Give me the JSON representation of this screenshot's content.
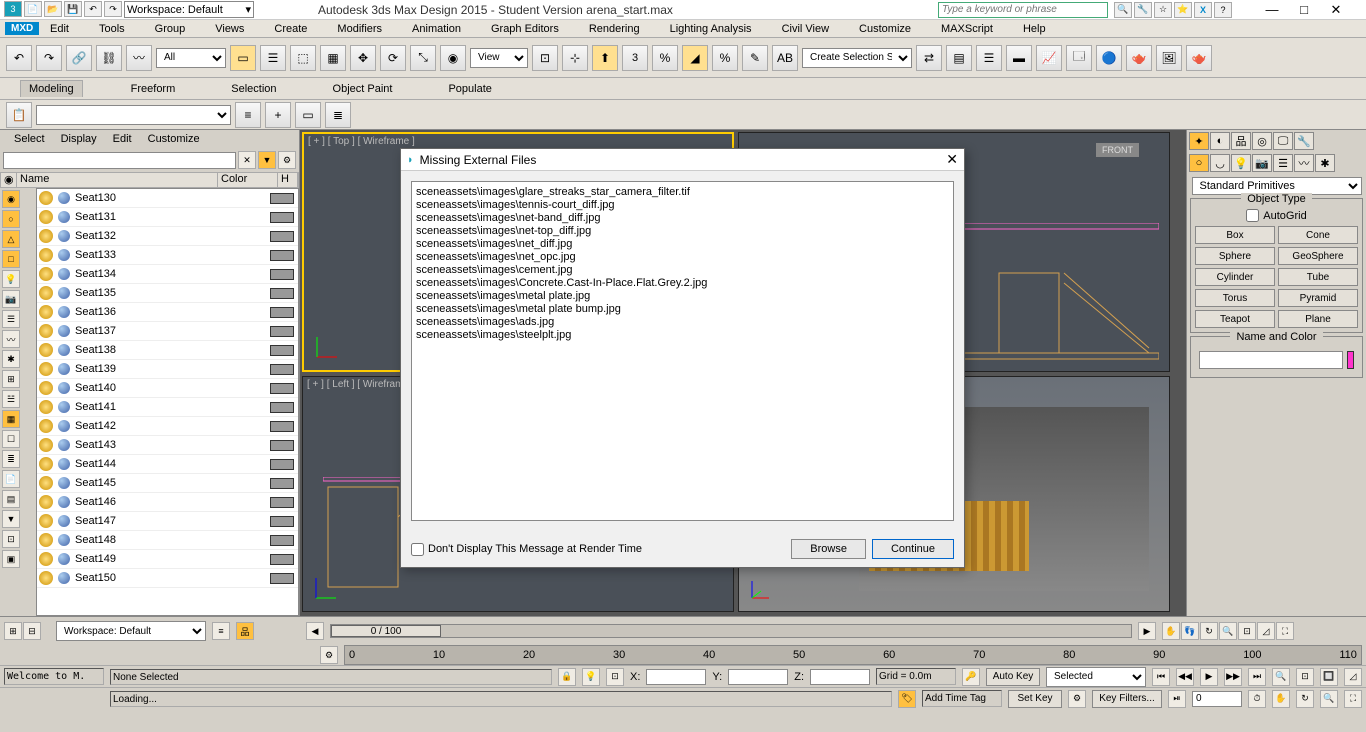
{
  "titlebar": {
    "workspace_label": "Workspace: Default",
    "app_title": "Autodesk 3ds Max Design 2015  - Student Version    arena_start.max",
    "search_placeholder": "Type a keyword or phrase"
  },
  "menubar": [
    "Edit",
    "Tools",
    "Group",
    "Views",
    "Create",
    "Modifiers",
    "Animation",
    "Graph Editors",
    "Rendering",
    "Lighting Analysis",
    "Civil View",
    "Customize",
    "MAXScript",
    "Help"
  ],
  "toolbar": {
    "filter_all": "All",
    "view": "View",
    "angle": "3",
    "selection_set": "Create Selection Se"
  },
  "ribbon_tabs": [
    "Modeling",
    "Freeform",
    "Selection",
    "Object Paint",
    "Populate"
  ],
  "scene_panel": {
    "menus": [
      "Select",
      "Display",
      "Edit",
      "Customize"
    ],
    "columns": {
      "name": "Name",
      "color": "Color",
      "h": "H"
    },
    "items": [
      {
        "name": "Seat130"
      },
      {
        "name": "Seat131"
      },
      {
        "name": "Seat132"
      },
      {
        "name": "Seat133"
      },
      {
        "name": "Seat134"
      },
      {
        "name": "Seat135"
      },
      {
        "name": "Seat136"
      },
      {
        "name": "Seat137"
      },
      {
        "name": "Seat138"
      },
      {
        "name": "Seat139"
      },
      {
        "name": "Seat140"
      },
      {
        "name": "Seat141"
      },
      {
        "name": "Seat142"
      },
      {
        "name": "Seat143"
      },
      {
        "name": "Seat144"
      },
      {
        "name": "Seat145"
      },
      {
        "name": "Seat146"
      },
      {
        "name": "Seat147"
      },
      {
        "name": "Seat148"
      },
      {
        "name": "Seat149"
      },
      {
        "name": "Seat150"
      }
    ]
  },
  "viewports": {
    "top": "[ + ] [ Top ] [ Wireframe ]",
    "front": "FRONT",
    "left": "[ + ] [ Left ] [ Wireframe ]"
  },
  "right_panel": {
    "category": "Standard Primitives",
    "object_type_label": "Object Type",
    "autogrid_label": "AutoGrid",
    "buttons": [
      "Box",
      "Cone",
      "Sphere",
      "GeoSphere",
      "Cylinder",
      "Tube",
      "Torus",
      "Pyramid",
      "Teapot",
      "Plane"
    ],
    "name_color_label": "Name and Color"
  },
  "dialog": {
    "title": "Missing External Files",
    "files": [
      "sceneassets\\images\\glare_streaks_star_camera_filter.tif",
      "sceneassets\\images\\tennis-court_diff.jpg",
      "sceneassets\\images\\net-band_diff.jpg",
      "sceneassets\\images\\net-top_diff.jpg",
      "sceneassets\\images\\net_diff.jpg",
      "sceneassets\\images\\net_opc.jpg",
      "sceneassets\\images\\cement.jpg",
      "sceneassets\\images\\Concrete.Cast-In-Place.Flat.Grey.2.jpg",
      "sceneassets\\images\\metal plate.jpg",
      "sceneassets\\images\\metal plate bump.jpg",
      "sceneassets\\images\\ads.jpg",
      "sceneassets\\images\\steelplt.jpg"
    ],
    "checkbox_label": "Don't Display This Message at Render Time",
    "browse": "Browse",
    "continue": "Continue"
  },
  "bottom": {
    "workspace": "Workspace: Default",
    "frame_display": "0 / 100",
    "ticks": [
      "0",
      "10",
      "20",
      "30",
      "40",
      "50",
      "60",
      "70",
      "80",
      "90",
      "100",
      "110"
    ],
    "selection": "None Selected",
    "x_label": "X:",
    "y_label": "Y:",
    "z_label": "Z:",
    "grid": "Grid = 0.0m",
    "autokey": "Auto Key",
    "setkey": "Set Key",
    "selected": "Selected",
    "keyfilters": "Key Filters...",
    "frame_value": "0",
    "tag": "Add Time Tag",
    "welcome": "Welcome to M.",
    "loading": "Loading..."
  }
}
